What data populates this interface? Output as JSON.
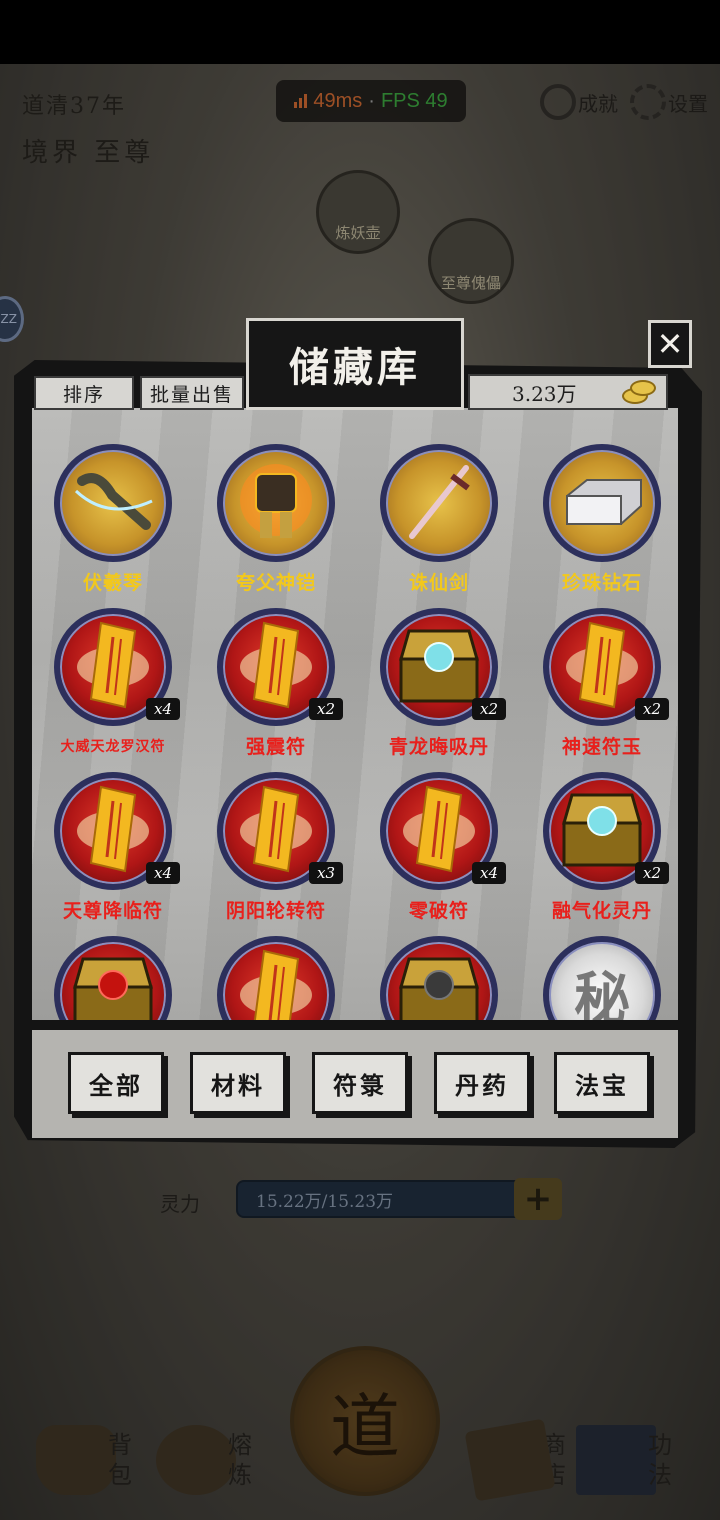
{
  "perf": {
    "latency": "49ms",
    "separator": "·",
    "fps": "FPS 49"
  },
  "hud": {
    "year": "道清37年",
    "realm": "境界 至尊",
    "achievements_label": "成就",
    "settings_label": "设置",
    "side_bubble": "ZZ",
    "scene_nodes": [
      "炼妖壶",
      "至尊傀儡"
    ]
  },
  "stats": {
    "lingli_label": "灵力",
    "lingli_value": "15.22万/15.23万",
    "plus": "+"
  },
  "center_button": "道",
  "bottom_nav": [
    {
      "label": "背包"
    },
    {
      "label": "熔炼"
    },
    {
      "label": "商店"
    },
    {
      "label": "功法"
    }
  ],
  "storage": {
    "title": "储藏库",
    "close": "✕",
    "sort_label": "排序",
    "batch_sell_label": "批量出售",
    "currency_amount": "3.23万",
    "items": [
      {
        "name": "伏羲琴",
        "count": "",
        "color": "#f2c81c",
        "orb": "gold",
        "icon": "qin-weapon"
      },
      {
        "name": "夸父神铠",
        "count": "",
        "color": "#f2c81c",
        "orb": "gold",
        "icon": "armor"
      },
      {
        "name": "诛仙剑",
        "count": "",
        "color": "#f2c81c",
        "orb": "gold",
        "icon": "sword"
      },
      {
        "name": "珍珠钻石",
        "count": "",
        "color": "#f2c81c",
        "orb": "gold",
        "icon": "diamond-block"
      },
      {
        "name": "大威天龙罗汉符",
        "count": "x4",
        "color": "#e8201c",
        "orb": "red",
        "icon": "talisman"
      },
      {
        "name": "强震符",
        "count": "x2",
        "color": "#e8201c",
        "orb": "red",
        "icon": "talisman"
      },
      {
        "name": "青龙晦吸丹",
        "count": "x2",
        "color": "#e8201c",
        "orb": "red",
        "icon": "chest-cyan"
      },
      {
        "name": "神速符玉",
        "count": "x2",
        "color": "#e8201c",
        "orb": "red",
        "icon": "talisman"
      },
      {
        "name": "天尊降临符",
        "count": "x4",
        "color": "#e8201c",
        "orb": "red",
        "icon": "talisman"
      },
      {
        "name": "阴阳轮转符",
        "count": "x3",
        "color": "#e8201c",
        "orb": "red",
        "icon": "talisman"
      },
      {
        "name": "零破符",
        "count": "x4",
        "color": "#e8201c",
        "orb": "red",
        "icon": "talisman"
      },
      {
        "name": "融气化灵丹",
        "count": "x2",
        "color": "#e8201c",
        "orb": "red",
        "icon": "chest-cyan"
      },
      {
        "name": "",
        "count": "",
        "color": "#e8201c",
        "orb": "red",
        "icon": "chest-red"
      },
      {
        "name": "",
        "count": "",
        "color": "#e8201c",
        "orb": "red",
        "icon": "talisman"
      },
      {
        "name": "",
        "count": "",
        "color": "#e8201c",
        "orb": "red",
        "icon": "chest-dark"
      },
      {
        "name": "",
        "count": "",
        "color": "#e8201c",
        "orb": "white",
        "icon": "secret",
        "glyph": "秘"
      }
    ],
    "tabs": [
      "全部",
      "材料",
      "符箓",
      "丹药",
      "法宝"
    ]
  }
}
